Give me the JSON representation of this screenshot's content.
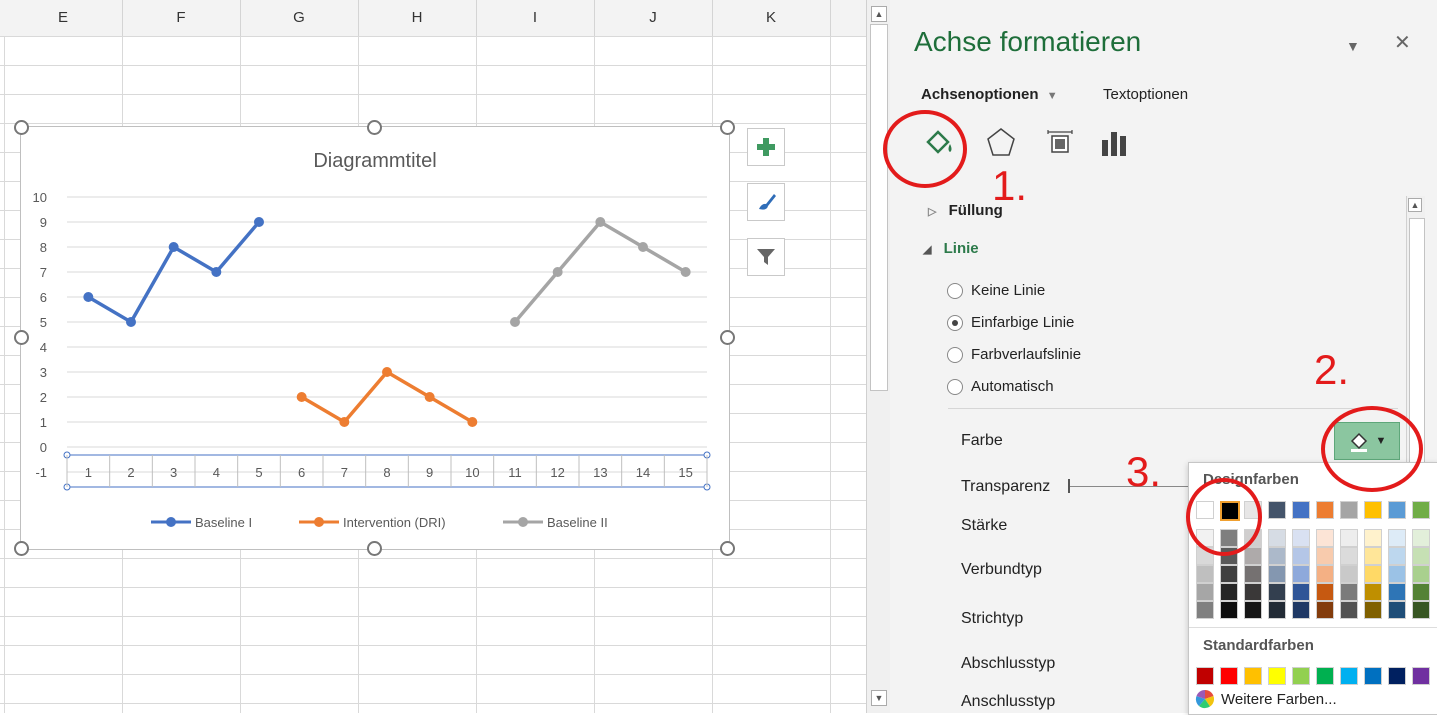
{
  "sheet": {
    "columns": [
      "E",
      "F",
      "G",
      "H",
      "I",
      "J",
      "K"
    ]
  },
  "chart": {
    "side_buttons": [
      "chart-elements-plus-icon",
      "chart-styles-brush-icon",
      "chart-filter-icon"
    ]
  },
  "chart_data": {
    "type": "line",
    "title": "Diagrammtitel",
    "xlabel": "",
    "ylabel": "",
    "x": [
      1,
      2,
      3,
      4,
      5,
      6,
      7,
      8,
      9,
      10,
      11,
      12,
      13,
      14,
      15
    ],
    "ylim": [
      -1,
      10
    ],
    "yticks": [
      -1,
      0,
      1,
      2,
      3,
      4,
      5,
      6,
      7,
      8,
      9,
      10
    ],
    "grid": true,
    "legend": "bottom",
    "series": [
      {
        "name": "Baseline I",
        "color": "#4472c4",
        "points": [
          [
            1,
            6
          ],
          [
            2,
            5
          ],
          [
            3,
            8
          ],
          [
            4,
            7
          ],
          [
            5,
            9
          ]
        ]
      },
      {
        "name": "Intervention (DRI)",
        "color": "#ed7d31",
        "points": [
          [
            6,
            2
          ],
          [
            7,
            1
          ],
          [
            8,
            3
          ],
          [
            9,
            2
          ],
          [
            10,
            1
          ]
        ]
      },
      {
        "name": "Baseline II",
        "color": "#a5a5a5",
        "points": [
          [
            11,
            5
          ],
          [
            12,
            7
          ],
          [
            13,
            9
          ],
          [
            14,
            8
          ],
          [
            15,
            7
          ]
        ]
      }
    ]
  },
  "pane": {
    "title": "Achse formatieren",
    "tab_axis": "Achsenoptionen",
    "tab_text": "Textoptionen",
    "section_fill": "Füllung",
    "section_line": "Linie",
    "radio_none": "Keine Linie",
    "radio_solid": "Einfarbige Linie",
    "radio_gradient": "Farbverlaufslinie",
    "radio_auto": "Automatisch",
    "prop_color": "Farbe",
    "prop_transparency": "Transparenz",
    "prop_width": "Stärke",
    "prop_compound": "Verbundtyp",
    "prop_dash": "Strichtyp",
    "prop_cap": "Abschlusstyp",
    "prop_join": "Anschlusstyp"
  },
  "dropdown": {
    "theme_header": "Designfarben",
    "standard_header": "Standardfarben",
    "more_colors": "Weitere Farben...",
    "theme_top": [
      "#ffffff",
      "#000000",
      "#e7e6e6",
      "#44546a",
      "#4472c4",
      "#ed7d31",
      "#a5a5a5",
      "#ffc000",
      "#5b9bd5",
      "#70ad47"
    ],
    "theme_shades": [
      [
        "#f2f2f2",
        "#7f7f7f",
        "#d0cece",
        "#d6dce4",
        "#d9e1f2",
        "#fce4d6",
        "#ededed",
        "#fff2cc",
        "#ddebf7",
        "#e2efda"
      ],
      [
        "#d9d9d9",
        "#595959",
        "#aeaaaa",
        "#acb9ca",
        "#b4c6e7",
        "#f8cbad",
        "#dbdbdb",
        "#ffe699",
        "#bdd7ee",
        "#c6e0b4"
      ],
      [
        "#bfbfbf",
        "#404040",
        "#757171",
        "#8497b0",
        "#8ea9db",
        "#f4b084",
        "#c9c9c9",
        "#ffd966",
        "#9bc2e6",
        "#a9d08e"
      ],
      [
        "#a6a6a6",
        "#262626",
        "#3a3838",
        "#333f4f",
        "#2f5597",
        "#c65911",
        "#7b7b7b",
        "#bf8f00",
        "#2e75b6",
        "#548235"
      ],
      [
        "#808080",
        "#0d0d0d",
        "#161616",
        "#222b35",
        "#1f3864",
        "#833c0c",
        "#525252",
        "#806000",
        "#1f4e78",
        "#375623"
      ]
    ],
    "standard": [
      "#c00000",
      "#ff0000",
      "#ffc000",
      "#ffff00",
      "#92d050",
      "#00b050",
      "#00b0f0",
      "#0070c0",
      "#002060",
      "#7030a0"
    ]
  },
  "annotations": [
    "1.",
    "2.",
    "3."
  ]
}
